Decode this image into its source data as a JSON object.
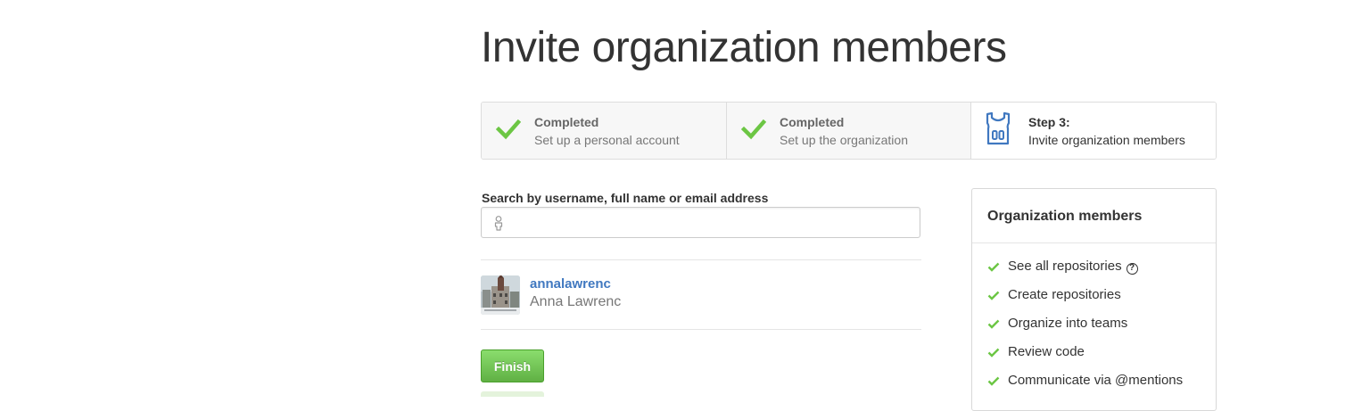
{
  "page": {
    "title": "Invite organization members"
  },
  "steps": [
    {
      "status": "Completed",
      "description": "Set up a personal account",
      "icon": "check-icon"
    },
    {
      "status": "Completed",
      "description": "Set up the organization",
      "icon": "check-icon"
    },
    {
      "status": "Step 3:",
      "description": "Invite organization members",
      "icon": "jersey-icon"
    }
  ],
  "search": {
    "label": "Search by username, full name or email address",
    "value": "",
    "placeholder": "",
    "icon": "person-icon"
  },
  "members": [
    {
      "login": "annalawrenc",
      "name": "Anna Lawrenc",
      "avatar": "avatar"
    }
  ],
  "actions": {
    "finish_label": "Finish"
  },
  "org_panel": {
    "title": "Organization members",
    "permissions": [
      {
        "label": "See all repositories",
        "has_help": true
      },
      {
        "label": "Create repositories"
      },
      {
        "label": "Organize into teams"
      },
      {
        "label": "Review code"
      },
      {
        "label": "Communicate via @mentions"
      }
    ]
  },
  "colors": {
    "accent_green": "#6cc644",
    "link_blue": "#4078c0",
    "icon_blue": "#4078c0",
    "button_green": "#60b044"
  }
}
